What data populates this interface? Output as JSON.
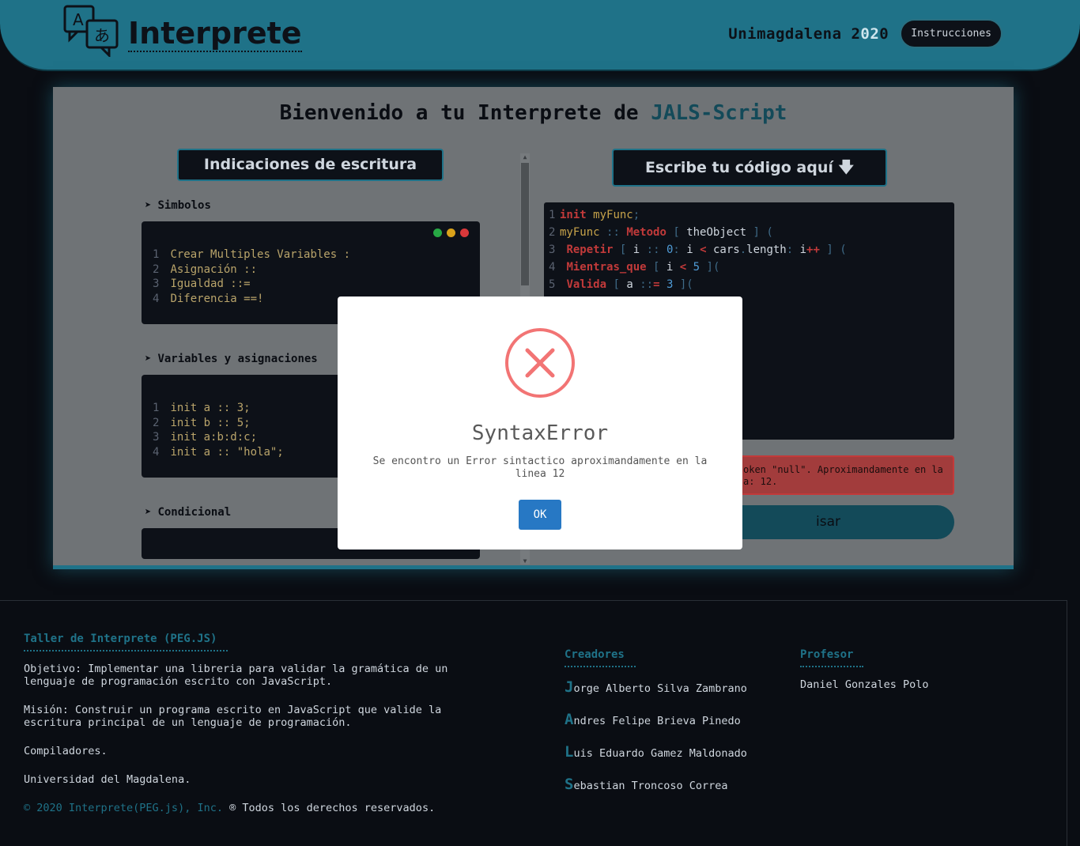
{
  "header": {
    "logo_first": "I",
    "logo_rest": "nterprete",
    "uni_main": "Unimagdalena 2",
    "uni_year": "02",
    "uni_end": "0",
    "instructions_label": "Instrucciones"
  },
  "main": {
    "title_prefix": "Bienvenido a tu Interprete de ",
    "title_accent": "JALS-Script",
    "indications_label": "Indicaciones de escritura",
    "write_label": "Escribe tu código aquí",
    "sections": [
      {
        "label": "Simbolos",
        "lines": [
          "Crear Multiples Variables :",
          "Asignación ::",
          "Igualdad ::=",
          "Diferencia ==!"
        ]
      },
      {
        "label": "Variables y asignaciones",
        "lines": [
          "init a :: 3;",
          "init b :: 5;",
          "init a:b:d:c;",
          "init a :: \"hola\";"
        ]
      },
      {
        "label": "Condicional",
        "lines": []
      }
    ],
    "error_text": "Token \"null\". Aproximandamente en la linea: 12.",
    "error_visible_a": "oken \"null\". Aproximandamente en la",
    "error_visible_b": "a: 12.",
    "review_label": "isar"
  },
  "editor": {
    "lines": [
      "init myFunc;",
      "myFunc :: Metodo [ theObject ] (",
      "Repetir [ i :: 0: i < cars.length: i++ ] (",
      "Mientras_que [ i < 5 ](",
      "Valida [ a ::= 3 ]("
    ]
  },
  "modal": {
    "title": "SyntaxError",
    "message": "Se encontro un Error sintactico aproximandamente en la linea 12",
    "ok_label": "OK"
  },
  "footer": {
    "title": "Taller de Interprete (PEG.JS)",
    "objective": "Objetivo: Implementar una libreria para validar la gramática de un lenguaje de programación escrito con JavaScript.",
    "mission": "Misión: Construir un programa escrito en JavaScript que valide la escritura principal de un lenguaje de programación.",
    "course": "Compiladores.",
    "university": "Universidad del Magdalena.",
    "copy_blue": "© 2020 Interprete(PEG.js), Inc.",
    "copy_rest": "® Todos los derechos reservados.",
    "creators_title": "Creadores",
    "creators": [
      {
        "cap": "J",
        "rest": "orge Alberto Silva Zambrano"
      },
      {
        "cap": "A",
        "rest": "ndres Felipe Brieva Pinedo"
      },
      {
        "cap": "L",
        "rest": "uis Eduardo Gamez Maldonado"
      },
      {
        "cap": "S",
        "rest": "ebastian Troncoso Correa"
      }
    ],
    "professor_title": "Profesor",
    "professor": "Daniel Gonzales Polo"
  },
  "colors": {
    "accent": "#1f7288",
    "error_ring": "#f27474",
    "ok_button": "#2778c4"
  }
}
